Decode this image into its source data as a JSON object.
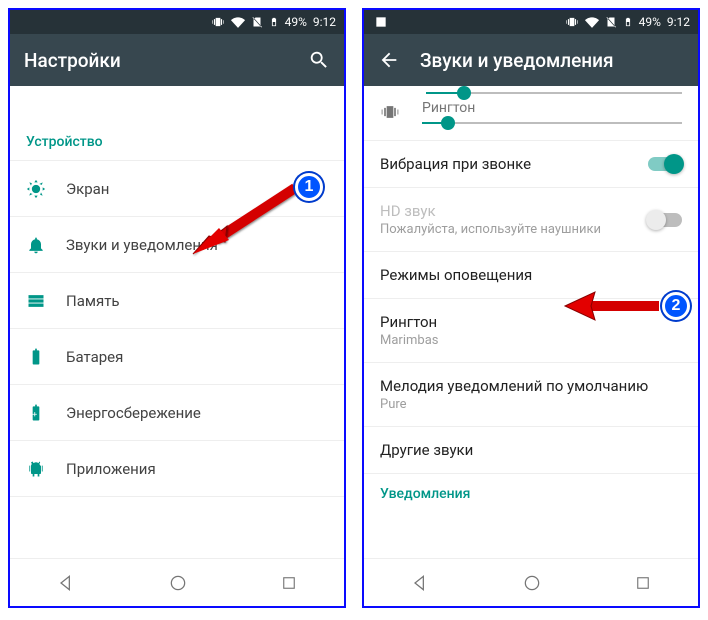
{
  "status": {
    "battery_pct": "49%",
    "time": "9:12"
  },
  "left": {
    "title": "Настройки",
    "section": "Устройство",
    "items": [
      {
        "label": "Экран"
      },
      {
        "label": "Звуки и уведомления"
      },
      {
        "label": "Память"
      },
      {
        "label": "Батарея"
      },
      {
        "label": "Энергосбережение"
      },
      {
        "label": "Приложения"
      }
    ]
  },
  "right": {
    "title": "Звуки и уведомления",
    "ringtone_slider_label": "Рингтон",
    "partial_slider_pct": 15,
    "ringtone_slider_pct": 10,
    "vibrate_label": "Вибрация при звонке",
    "vibrate_on": true,
    "hd_title": "HD звук",
    "hd_sub": "Пожалуйста, используйте наушники",
    "hd_on": false,
    "modes_label": "Режимы оповещения",
    "ringtone_title": "Рингтон",
    "ringtone_value": "Marimbas",
    "notif_title": "Мелодия уведомлений по умолчанию",
    "notif_value": "Pure",
    "other_label": "Другие звуки",
    "notif_section": "Уведомления"
  },
  "annotations": {
    "badge1": "1",
    "badge2": "2"
  }
}
